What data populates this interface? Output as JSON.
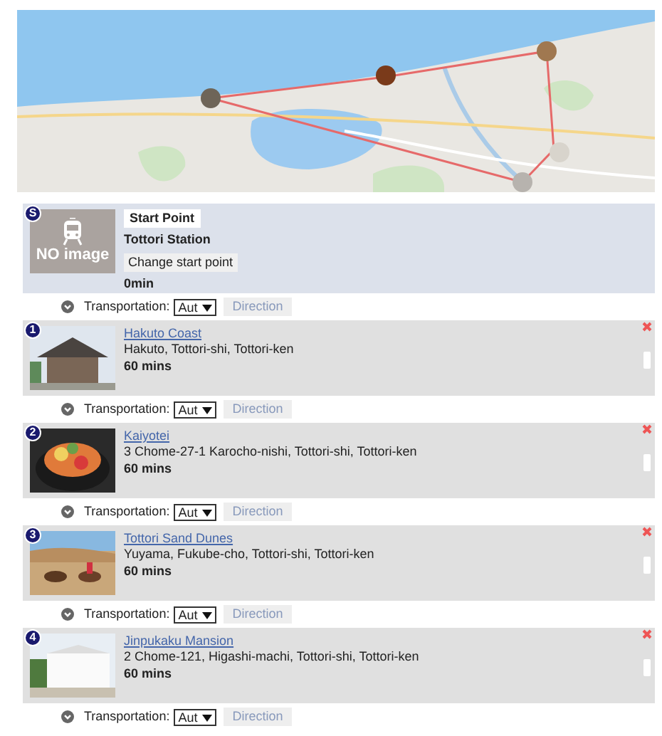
{
  "start": {
    "badge": "S",
    "label": "Start Point",
    "name": "Tottori Station",
    "button": "Change start point",
    "duration": "0min",
    "image_text": "NO image"
  },
  "segments": [
    {
      "label": "Transportation:",
      "mode": "Aut",
      "button": "Direction"
    },
    {
      "label": "Transportation:",
      "mode": "Aut",
      "button": "Direction"
    },
    {
      "label": "Transportation:",
      "mode": "Aut",
      "button": "Direction"
    },
    {
      "label": "Transportation:",
      "mode": "Aut",
      "button": "Direction"
    },
    {
      "label": "Transportation:",
      "mode": "Aut",
      "button": "Direction"
    }
  ],
  "stops": [
    {
      "number": "1",
      "name": "Hakuto Coast",
      "address": "Hakuto, Tottori-shi, Tottori-ken",
      "duration": "60 mins"
    },
    {
      "number": "2",
      "name": "Kaiyotei",
      "address": "3 Chome-27-1 Karocho-nishi, Tottori-shi, Tottori-ken",
      "duration": "60 mins"
    },
    {
      "number": "3",
      "name": "Tottori Sand Dunes",
      "address": "Yuyama, Fukube-cho, Tottori-shi, Tottori-ken",
      "duration": "60 mins"
    },
    {
      "number": "4",
      "name": "Jinpukaku Mansion",
      "address": "2 Chome-121, Higashi-machi, Tottori-shi, Tottori-ken",
      "duration": "60 mins"
    }
  ]
}
